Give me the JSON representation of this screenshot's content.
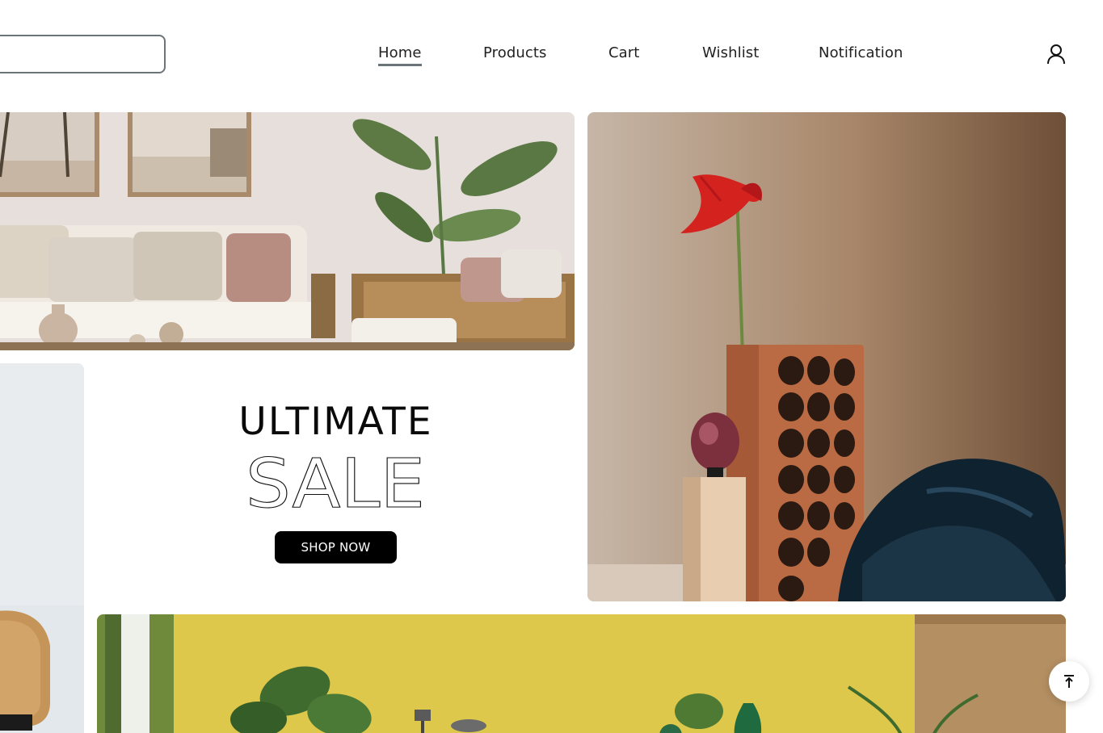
{
  "search": {
    "placeholder": "",
    "value": ""
  },
  "nav": {
    "items": [
      {
        "label": "Home",
        "active": true
      },
      {
        "label": "Products",
        "active": false
      },
      {
        "label": "Cart",
        "active": false
      },
      {
        "label": "Wishlist",
        "active": false
      },
      {
        "label": "Notification",
        "active": false
      }
    ]
  },
  "icons": {
    "user": "user-icon",
    "scroll_top": "arrow-up-to-line-icon"
  },
  "promo": {
    "line1": "ULTIMATE",
    "line2": "SALE",
    "button_label": "SHOP NOW"
  },
  "colors": {
    "accent": "#6b7478",
    "button_bg": "#000000",
    "button_text": "#ffffff"
  }
}
